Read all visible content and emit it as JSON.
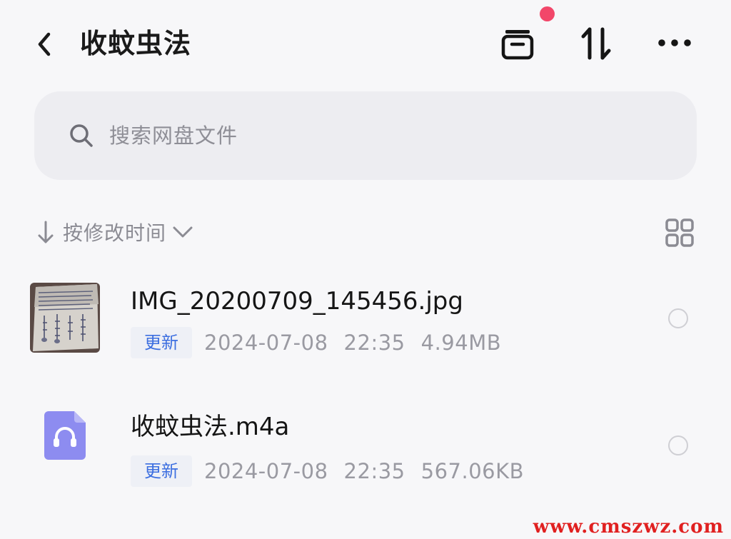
{
  "header": {
    "title": "收蚊虫法",
    "back_icon": "chevron-left-icon",
    "archive_icon": "archive-box-icon",
    "sort_icon": "sort-arrows-icon",
    "more_icon": "ellipsis-icon",
    "notification_dot_color": "#f2476a"
  },
  "search": {
    "placeholder": "搜索网盘文件",
    "icon": "search-icon"
  },
  "sort": {
    "label": "按修改时间",
    "direction_icon": "arrow-down-icon",
    "dropdown_icon": "chevron-down-icon"
  },
  "view_toggle_icon": "grid-view-icon",
  "files": [
    {
      "name": "IMG_20200709_145456.jpg",
      "badge": "更新",
      "date": "2024-07-08",
      "time": "22:35",
      "size": "4.94MB",
      "icon": "image-thumbnail"
    },
    {
      "name": "收蚊虫法.m4a",
      "badge": "更新",
      "date": "2024-07-08",
      "time": "22:35",
      "size": "567.06KB",
      "icon": "audio-file-icon"
    }
  ],
  "watermark": "www.cmszwz.com",
  "colors": {
    "background": "#f7f7f9",
    "search_bg": "#ededf1",
    "badge_text": "#3d6fe0",
    "audio_icon": "#8d8cf0",
    "watermark": "#e02020"
  }
}
